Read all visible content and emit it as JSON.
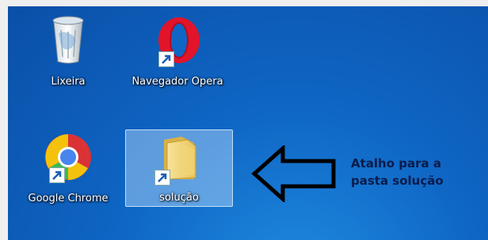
{
  "desktop": {
    "icons": [
      {
        "label": "Lixeira",
        "icon": "recycle-bin-icon",
        "shortcut": false,
        "selected": false
      },
      {
        "label": "Navegador Opera",
        "icon": "opera-icon",
        "shortcut": true,
        "selected": false
      },
      {
        "label": "Google Chrome",
        "icon": "chrome-icon",
        "shortcut": true,
        "selected": false
      },
      {
        "label": "solução",
        "icon": "folder-icon",
        "shortcut": true,
        "selected": true
      }
    ]
  },
  "annotation": {
    "line1": "Atalho para a",
    "line2": "pasta solução"
  },
  "colors": {
    "desktop_blue": "#0f66c4",
    "selection": "#bee1ff",
    "note_text": "#0b1b4a"
  }
}
